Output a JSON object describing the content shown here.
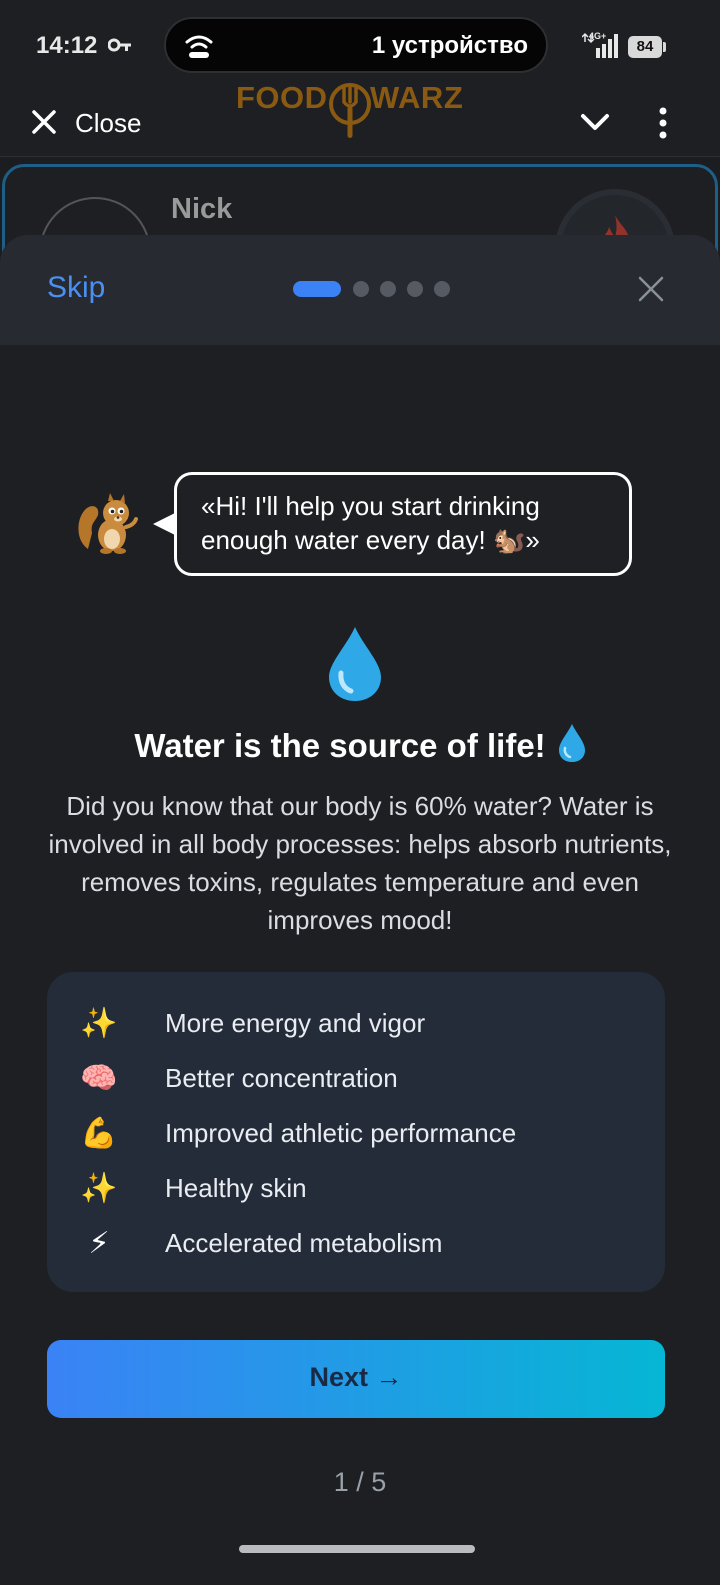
{
  "status_bar": {
    "time": "14:12",
    "cast_label": "1 устройство",
    "network": "4G+",
    "battery": "84"
  },
  "app_header": {
    "close_label": "Close",
    "logo_left": "FOOD",
    "logo_right": "WARZ"
  },
  "profile": {
    "name": "Nick"
  },
  "onboarding": {
    "skip_label": "Skip",
    "current_step": 1,
    "total_steps": 5,
    "mascot_message": "«Hi! I'll help you start drinking enough water every day! 🐿️»",
    "headline": "Water is the source of life!",
    "body": "Did you know that our body is 60% water? Water is involved in all body processes: helps absorb nutrients, removes toxins, regulates temperature and even improves mood!",
    "benefits": [
      {
        "icon": "✨",
        "icon_name": "sparkles-icon",
        "label": "More energy and vigor"
      },
      {
        "icon": "🧠",
        "icon_name": "brain-icon",
        "label": "Better concentration"
      },
      {
        "icon": "💪",
        "icon_name": "flexed-biceps-icon",
        "label": "Improved athletic performance"
      },
      {
        "icon": "✨",
        "icon_name": "sparkles-icon",
        "label": "Healthy skin"
      },
      {
        "icon": "⚡",
        "icon_name": "lightning-icon",
        "label": "Accelerated metabolism"
      }
    ],
    "next_label": "Next →",
    "page_counter": "1 / 5"
  },
  "colors": {
    "accent": "#3b82f6",
    "gradient_end": "#06b6d4",
    "logo": "#8a5a12",
    "panel": "#252c39"
  }
}
